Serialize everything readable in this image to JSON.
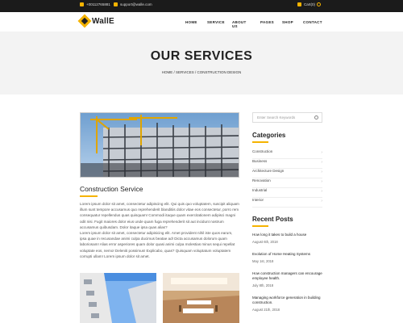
{
  "topbar": {
    "phone": "+00112765881",
    "email": "support@walle.com",
    "cart": "Cart(0)"
  },
  "header": {
    "logo": "WallE",
    "nav": [
      "HOME",
      "SERVICE",
      "ABOUT US",
      "PAGES",
      "SHOP",
      "CONTACT"
    ]
  },
  "hero": {
    "title": "OUR SERVICES",
    "breadcrumb": "HOME / SERVICES / CONSTRUCTION DESIGN"
  },
  "main": {
    "title": "Construction Service",
    "para1": "Lorem ipsum dolor sit amet, consectetur adipiscing elit. Qui quis quo voluptatem, suscipit aliquam illum sunt tempore accusamus quo reprehenderit blanditiis dolor vitae eos consectetur, porro rem consequatur repellendus quas quisquam! Commodi itaque quam exercitationem adipisci magni odit nisi. Fugit maiores dolor eius unde quam fuga reprehenderit sit aut incidunt nostrum accusamus quibusdam. Dolor itaque ipsa quas alias?",
    "para2": "Lorem ipsum dolor sit amet, consectetur adipisicing elit. Amet provident nihil iste quos earum, ipsa quae in recusandae animi culpa ducimus beatae ad! Dicta accusamus dolorum quam laboriosam! Alias error asperiores quam dolor quasi animi culpa molestias minus sequi repellat voluptate eos, nemo! Deleniti possimus! Explicabo, quas? Quisquam voluptatum voluptatem corrupti ullam! Lorem ipsum dolor sit amet."
  },
  "sidebar": {
    "search_placeholder": "Enter Search Keywords",
    "categories_title": "Categories",
    "categories": [
      "Construction",
      "Business",
      "Architecture Design",
      "Renovation",
      "Industrial",
      "Interior"
    ],
    "recent_title": "Recent Posts",
    "posts": [
      {
        "title": "How long it takes to build a house",
        "date": "August 6th, 2018"
      },
      {
        "title": "Evolution of Home Heating Systems",
        "date": "May 1st, 2018"
      },
      {
        "title": "How construction managers can encourage employee health.",
        "date": "July 8th, 2018"
      },
      {
        "title": "Managing workforce generation in building construction.",
        "date": "August 21th, 2018"
      }
    ]
  },
  "colors": {
    "accent": "#f5b301",
    "topbar": "#1b1b1b",
    "hero_bg": "#f3f3f3"
  }
}
